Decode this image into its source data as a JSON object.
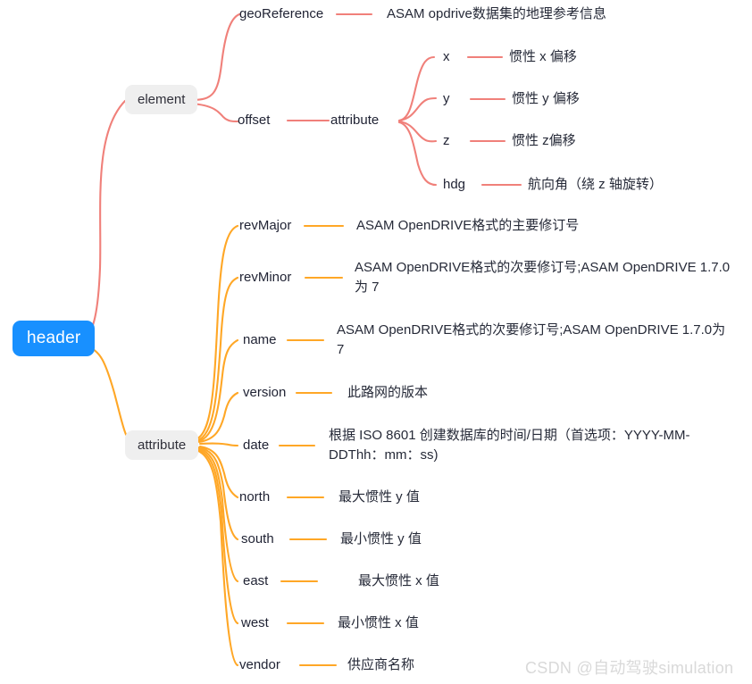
{
  "diagram": {
    "type": "mindmap",
    "title": "header",
    "colors": {
      "root_fill": "#1890ff",
      "root_text": "#ffffff",
      "box_fill": "#efefef",
      "box_text": "#30303a",
      "branch_element": "#f0807a",
      "branch_attribute": "#ffa726",
      "text": "#1f2233",
      "background": "#ffffff",
      "watermark": "#d9d9d9"
    },
    "root": {
      "label": "header"
    },
    "branches": [
      {
        "label": "element",
        "color": "#f0807a",
        "children": [
          {
            "label": "geoReference",
            "description": "ASAM opdrive数据集的地理参考信息"
          },
          {
            "label": "offset",
            "child_label": "attribute",
            "children": [
              {
                "label": "x",
                "description": "惯性 x 偏移"
              },
              {
                "label": "y",
                "description": "惯性 y 偏移"
              },
              {
                "label": "z",
                "description": "惯性 z偏移"
              },
              {
                "label": "hdg",
                "description": "航向角（绕 z 轴旋转）"
              }
            ]
          }
        ]
      },
      {
        "label": "attribute",
        "color": "#ffa726",
        "children": [
          {
            "label": "revMajor",
            "description": "ASAM OpenDRIVE格式的主要修订号"
          },
          {
            "label": "revMinor",
            "description": "ASAM OpenDRIVE格式的次要修订号;ASAM OpenDRIVE 1.7.0为 7"
          },
          {
            "label": "name",
            "description": "ASAM OpenDRIVE格式的次要修订号;ASAM OpenDRIVE 1.7.0为 7"
          },
          {
            "label": "version",
            "description": "此路网的版本"
          },
          {
            "label": "date",
            "description": "根据 ISO 8601 创建数据库的时间/日期（首选项：YYYY-MM-DDThh：mm：ss)"
          },
          {
            "label": "north",
            "description": "最大惯性 y 值"
          },
          {
            "label": "south",
            "description": "最小惯性 y 值"
          },
          {
            "label": "east",
            "description": "最大惯性 x 值"
          },
          {
            "label": "west",
            "description": "最小惯性 x 值"
          },
          {
            "label": "vendor",
            "description": "供应商名称"
          }
        ]
      }
    ]
  },
  "watermark": {
    "text": "CSDN @自动驾驶simulation"
  }
}
